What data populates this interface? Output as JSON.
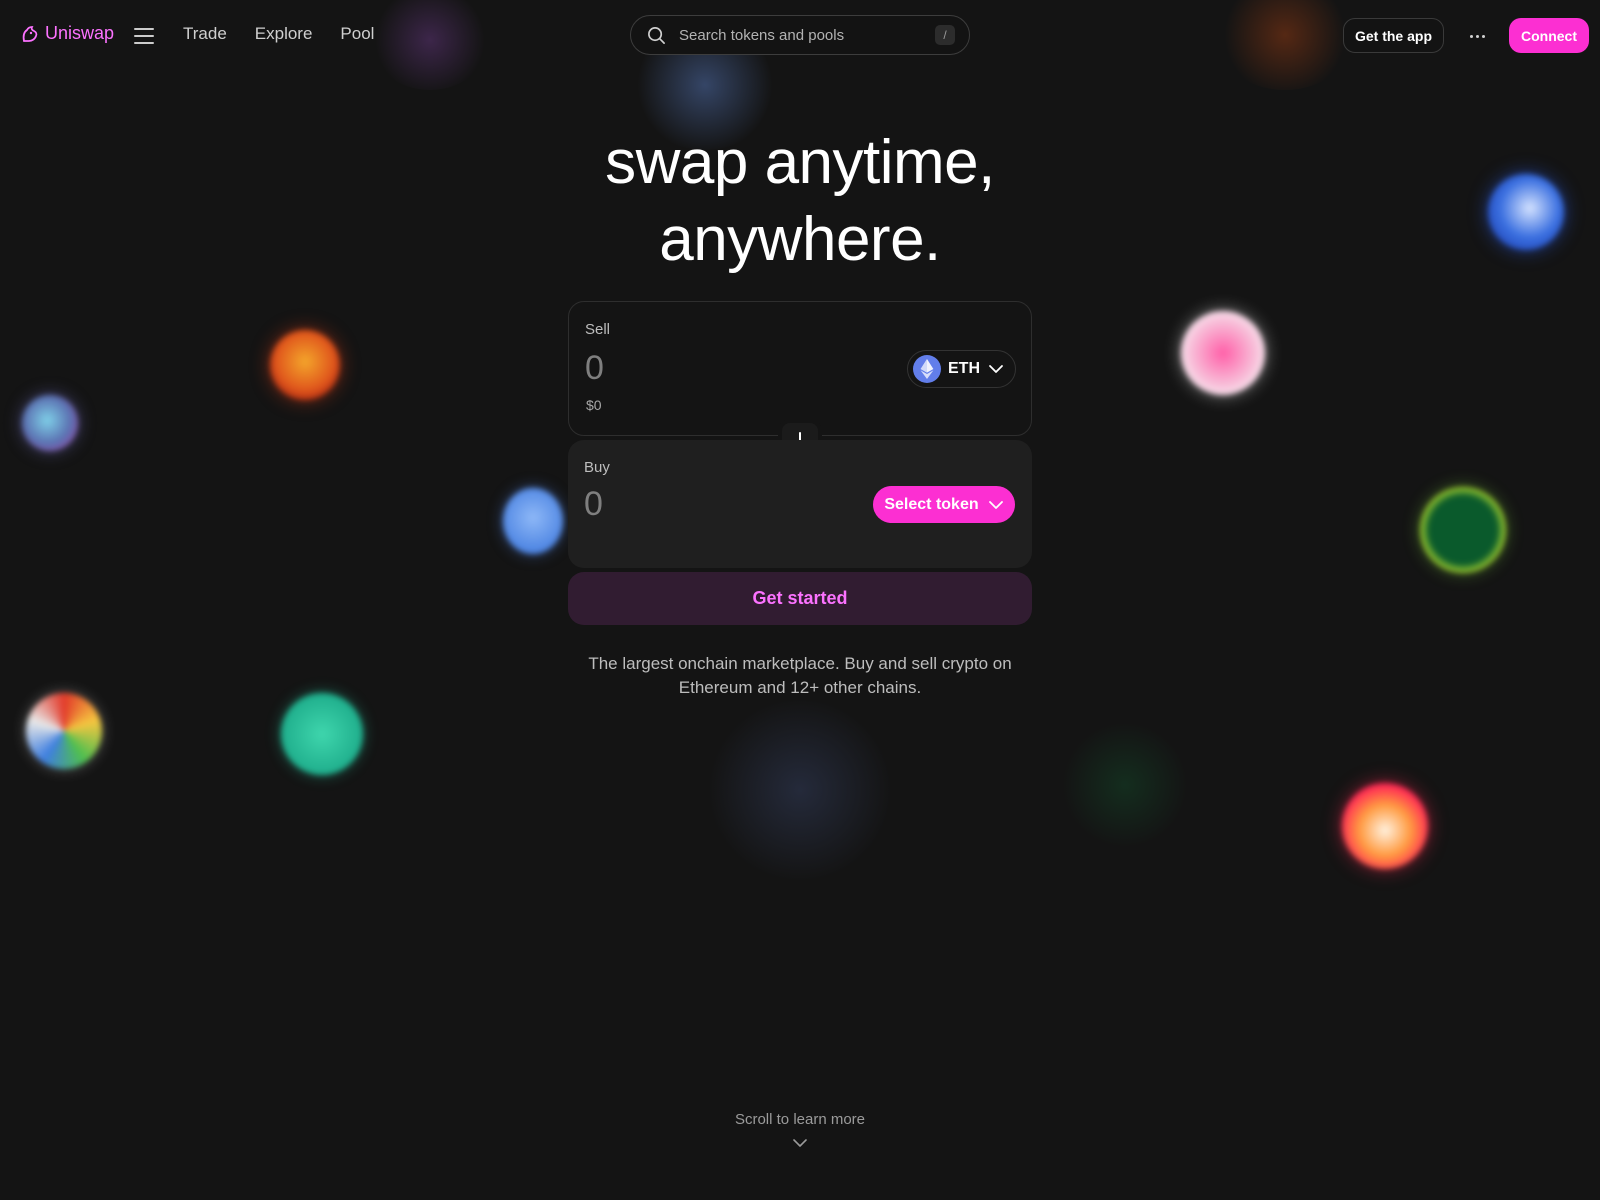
{
  "header": {
    "brand": "Uniswap",
    "nav": [
      "Trade",
      "Explore",
      "Pool"
    ],
    "search_placeholder": "Search tokens and pools",
    "search_shortcut": "/",
    "get_app_label": "Get the app",
    "connect_label": "Connect"
  },
  "hero": {
    "title_line1": "swap anytime,",
    "title_line2": "anywhere."
  },
  "swap": {
    "sell": {
      "label": "Sell",
      "amount_placeholder": "0",
      "usd_value": "$0",
      "token": "ETH",
      "token_icon": "eth-icon"
    },
    "buy": {
      "label": "Buy",
      "amount_placeholder": "0",
      "select_label": "Select token"
    },
    "cta_label": "Get started"
  },
  "tagline": "The largest onchain marketplace. Buy and sell crypto on Ethereum and 12+ other chains.",
  "scroll_hint": "Scroll to learn more",
  "colors": {
    "accent": "#fc2fd2",
    "accent_soft": "#fc72ff",
    "background": "#141414",
    "eth": "#627eea"
  }
}
